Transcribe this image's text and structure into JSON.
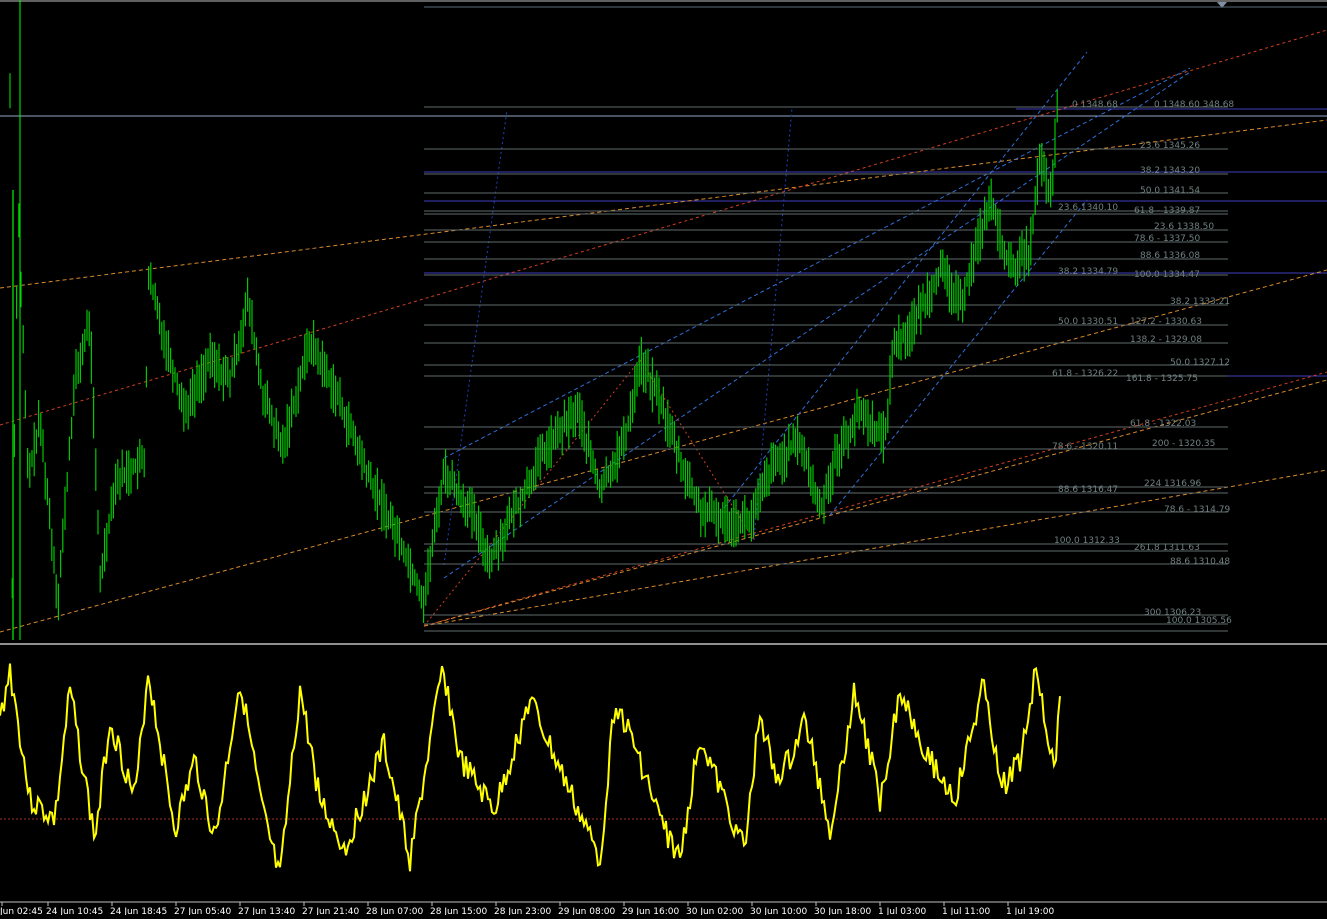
{
  "app": {
    "type": "trading-terminal-chart",
    "symbol_hint": "XAUUSD",
    "colors": {
      "background": "#000000",
      "candles": "#00c800",
      "oscillator": "#ffff00",
      "fib_levels": "#5f6b6b",
      "channel_blue": "#2f6fd6",
      "channel_orange": "#d88a2a",
      "channel_red": "#d04020",
      "separator": "#c0c0c0",
      "h_lines": "#4040c0"
    }
  },
  "price_labels": [
    {
      "text": "0 1348.68"
    },
    {
      "text": "0 1348.60 348.68"
    },
    {
      "text": "23.6 1345.26"
    },
    {
      "text": "38.2 1343.20"
    },
    {
      "text": "50.0 1341.54"
    },
    {
      "text": "23.6 1340.10"
    },
    {
      "text": "61.8 - 1339.87"
    },
    {
      "text": "23.6 1338.50"
    },
    {
      "text": "78.6 - 1337.50"
    },
    {
      "text": "88.6 1336.08"
    },
    {
      "text": "38.2 1334.79"
    },
    {
      "text": "100.0 1334.47"
    },
    {
      "text": "38.2 1333.21"
    },
    {
      "text": "50.0 1330.51"
    },
    {
      "text": "127.2 - 1330.63"
    },
    {
      "text": "138.2 - 1329.08"
    },
    {
      "text": "50.0 1327.12"
    },
    {
      "text": "61.8 - 1326.22"
    },
    {
      "text": "161.8 - 1325.75"
    },
    {
      "text": "61.8 - 1322.03"
    },
    {
      "text": "78.6 - 1320.11"
    },
    {
      "text": "200 - 1320.35"
    },
    {
      "text": "88.6 1316.47"
    },
    {
      "text": "224 1316.96"
    },
    {
      "text": "78.6 - 1314.79"
    },
    {
      "text": "100.0 1312.33"
    },
    {
      "text": "261.8 1311.63"
    },
    {
      "text": "88.6 1310.48"
    },
    {
      "text": "300 1306.23"
    },
    {
      "text": "100.0 1305.56"
    }
  ],
  "time_axis": [
    "Jun 02:45",
    "24 Jun 10:45",
    "24 Jun 18:45",
    "27 Jun 05:40",
    "27 Jun 13:40",
    "27 Jun 21:40",
    "28 Jun 07:00",
    "28 Jun 15:00",
    "28 Jun 23:00",
    "29 Jun 08:00",
    "29 Jun 16:00",
    "30 Jun 02:00",
    "30 Jun 10:00",
    "30 Jun 18:00",
    "1 Jul 03:00",
    "1 Jul 11:00",
    "1 Jul 19:00"
  ]
}
